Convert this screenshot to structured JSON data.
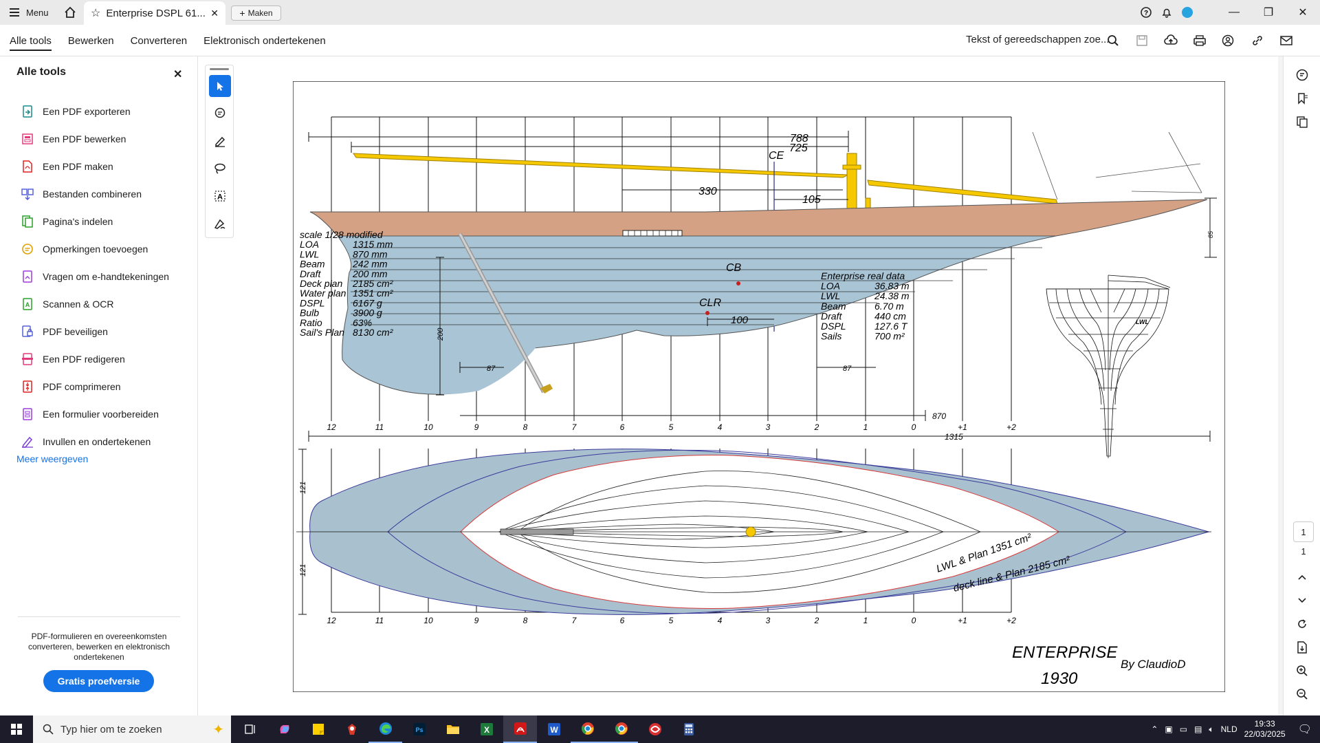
{
  "titlebar": {
    "menu_label": "Menu",
    "tab_title": "Enterprise DSPL 61...",
    "maken_label": "Maken"
  },
  "toolbar": {
    "tabs": [
      "Alle tools",
      "Bewerken",
      "Converteren",
      "Elektronisch ondertekenen"
    ],
    "search_placeholder": "Tekst of gereedschappen zoe..."
  },
  "left_panel": {
    "title": "Alle tools",
    "items": [
      {
        "label": "Een PDF exporteren",
        "icon": "export-pdf-icon",
        "color": "#1a8a8a"
      },
      {
        "label": "Een PDF bewerken",
        "icon": "edit-pdf-icon",
        "color": "#e03a7a"
      },
      {
        "label": "Een PDF maken",
        "icon": "create-pdf-icon",
        "color": "#e02020"
      },
      {
        "label": "Bestanden combineren",
        "icon": "combine-files-icon",
        "color": "#5560d8"
      },
      {
        "label": "Pagina's indelen",
        "icon": "organize-pages-icon",
        "color": "#2aa02a"
      },
      {
        "label": "Opmerkingen toevoegen",
        "icon": "comment-icon",
        "color": "#e0a000"
      },
      {
        "label": "Vragen om e-handtekeningen",
        "icon": "request-esign-icon",
        "color": "#9b3cd8"
      },
      {
        "label": "Scannen & OCR",
        "icon": "scan-ocr-icon",
        "color": "#2aa02a"
      },
      {
        "label": "PDF beveiligen",
        "icon": "protect-pdf-icon",
        "color": "#5560d8"
      },
      {
        "label": "Een PDF redigeren",
        "icon": "redact-pdf-icon",
        "color": "#e03a7a"
      },
      {
        "label": "PDF comprimeren",
        "icon": "compress-pdf-icon",
        "color": "#e02020"
      },
      {
        "label": "Een formulier voorbereiden",
        "icon": "prepare-form-icon",
        "color": "#9b3cd8"
      },
      {
        "label": "Invullen en ondertekenen",
        "icon": "fill-sign-icon",
        "color": "#7a3cd8"
      }
    ],
    "more_label": "Meer weergeven",
    "promo_text": "PDF-formulieren en overeenkomsten converteren, bewerken en elektronisch ondertekenen",
    "trial_label": "Gratis proefversie"
  },
  "page_nav": {
    "current": "1",
    "total": "1"
  },
  "drawing": {
    "dim_788": "788",
    "dim_725": "725",
    "label_ce": "CE",
    "dim_330": "330",
    "dim_105": "105",
    "label_cb": "CB",
    "label_clr": "CLR",
    "dim_100": "100",
    "dim_200": "200",
    "dim_87_left": "87",
    "dim_87_right": "87",
    "dim_85": "85",
    "dim_870": "870",
    "dim_1315": "1315",
    "dim_121_top": "121",
    "dim_121_bottom": "121",
    "lwl_label": "LWL",
    "station_labels": [
      "12",
      "11",
      "10",
      "9",
      "8",
      "7",
      "6",
      "5",
      "4",
      "3",
      "2",
      "1",
      "0",
      "+1",
      "+2"
    ],
    "model_specs": [
      [
        "scale 1/28  modified",
        ""
      ],
      [
        "LOA",
        "1315 mm"
      ],
      [
        "LWL",
        "870 mm"
      ],
      [
        "Beam",
        "242 mm"
      ],
      [
        "Draft",
        "200 mm"
      ],
      [
        "Deck plan",
        "2185 cm²"
      ],
      [
        "Water plan",
        "1351 cm²"
      ],
      [
        "DSPL",
        "6167 g"
      ],
      [
        "Bulb",
        "3900 g"
      ],
      [
        "Ratio",
        "63%"
      ],
      [
        "Sail's  Plan",
        "8130 cm²"
      ]
    ],
    "real_specs": [
      [
        "Enterprise real  data",
        ""
      ],
      [
        "LOA",
        "36.83 m"
      ],
      [
        "LWL",
        "24.38 m"
      ],
      [
        "Beam",
        "6.70 m"
      ],
      [
        "Draft",
        "440 cm"
      ],
      [
        "DSPL",
        "127.6 T"
      ],
      [
        "Sails",
        "700 m²"
      ]
    ],
    "lwl_plan_label": "LWL  & Plan  1351 cm²",
    "deck_plan_label": "deck line  & Plan  2185 cm²",
    "title_name": "ENTERPRISE",
    "title_year": "1930",
    "author": "By  ClaudioD"
  },
  "taskbar": {
    "search_placeholder": "Typ hier om te zoeken",
    "language": "NLD",
    "time": "19:33",
    "date": "22/03/2025"
  },
  "colors": {
    "accent": "#1473e6",
    "hull_topside": "#d4a184",
    "underwater": "#a9c4d4",
    "spar_yellow": "#f5c800",
    "deck_fill": "#a9c0cf"
  }
}
